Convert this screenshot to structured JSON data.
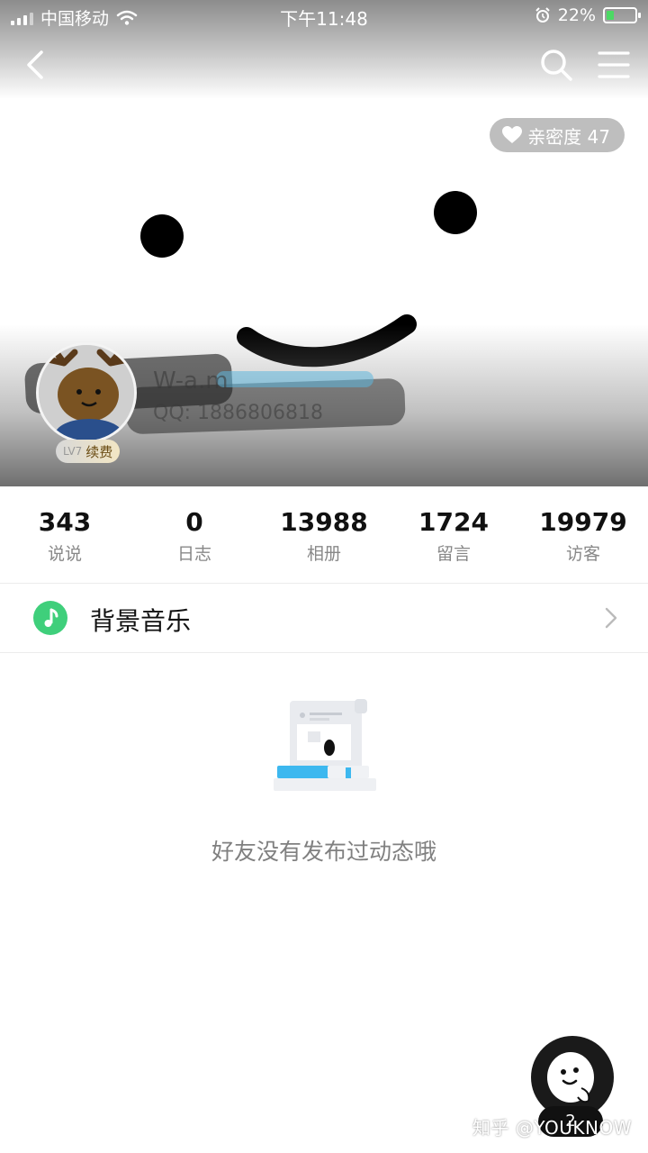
{
  "status_bar": {
    "carrier": "中国移动",
    "time": "下午11:48",
    "battery_percent": "22%"
  },
  "header": {
    "intimacy_label": "亲密度 47"
  },
  "profile": {
    "name": "W-a.m",
    "qq": "QQ: 1886806818",
    "vip_level": "LV7",
    "vip_action": "续费"
  },
  "stats": [
    {
      "value": "343",
      "label": "说说"
    },
    {
      "value": "0",
      "label": "日志"
    },
    {
      "value": "13988",
      "label": "相册"
    },
    {
      "value": "1724",
      "label": "留言"
    },
    {
      "value": "19979",
      "label": "访客"
    }
  ],
  "music": {
    "label": "背景音乐"
  },
  "empty_state": {
    "message": "好友没有发布过动态哦"
  },
  "fab": {
    "count": "2"
  },
  "watermark": "知乎 @YOUKNOW",
  "colors": {
    "accent_green": "#3fcf7b",
    "battery_green": "#4cd964",
    "muted_text": "#888888"
  }
}
